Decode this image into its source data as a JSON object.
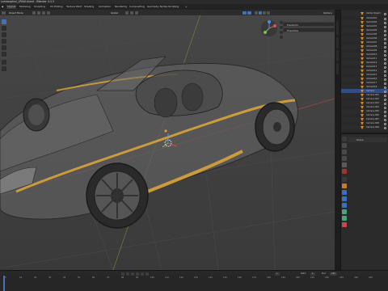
{
  "title_bar": {
    "text": "Lamborghini_LP640.blend - Blender 4.4.3"
  },
  "menu": {
    "items": [
      "Layout",
      "Modeling",
      "Sculpting",
      "UV Editing",
      "Texture Paint",
      "Shading",
      "Animation",
      "Rendering",
      "Compositing",
      "Geometry Nodes",
      "Scripting"
    ],
    "active_index": 0
  },
  "viewport": {
    "mode_label": "Object Mode",
    "view_label": "Global",
    "panels": [
      "Transform",
      "Properties"
    ],
    "side_tabs": [
      "Item",
      "Tool",
      "View",
      "Edit"
    ],
    "options_label": "Options",
    "accent": "#4772b3"
  },
  "outliner": {
    "rows": [
      "Vertex Object",
      "Vertex001",
      "Vertex002",
      "Vertex003",
      "Vertex004",
      "Vertex005",
      "Vertex006",
      "Vertex007",
      "Vertex008",
      "Vertex009",
      "Vertex010",
      "Vertex011",
      "Vertex012",
      "Vertex013",
      "Vertex014",
      "Vertex015",
      "Vertex016",
      "Vertex017",
      "Vertex018",
      "Camera",
      "Camera.001",
      "Camera.002",
      "Camera.003",
      "Camera.004",
      "Camera.005",
      "Camera.006",
      "Camera.007",
      "Camera.008",
      "Camera.009"
    ],
    "selected_index": 19
  },
  "properties": {
    "label": "Scene"
  },
  "timeline": {
    "ticks": [
      "0",
      "10",
      "20",
      "30",
      "40",
      "50",
      "60",
      "70",
      "80",
      "90",
      "100",
      "110",
      "120",
      "130",
      "140",
      "150",
      "160",
      "170",
      "180",
      "190",
      "200",
      "210",
      "220",
      "230",
      "240",
      "250"
    ],
    "start_label": "Start",
    "start": "1",
    "end_label": "End",
    "end": "250",
    "current_frame": "1"
  }
}
